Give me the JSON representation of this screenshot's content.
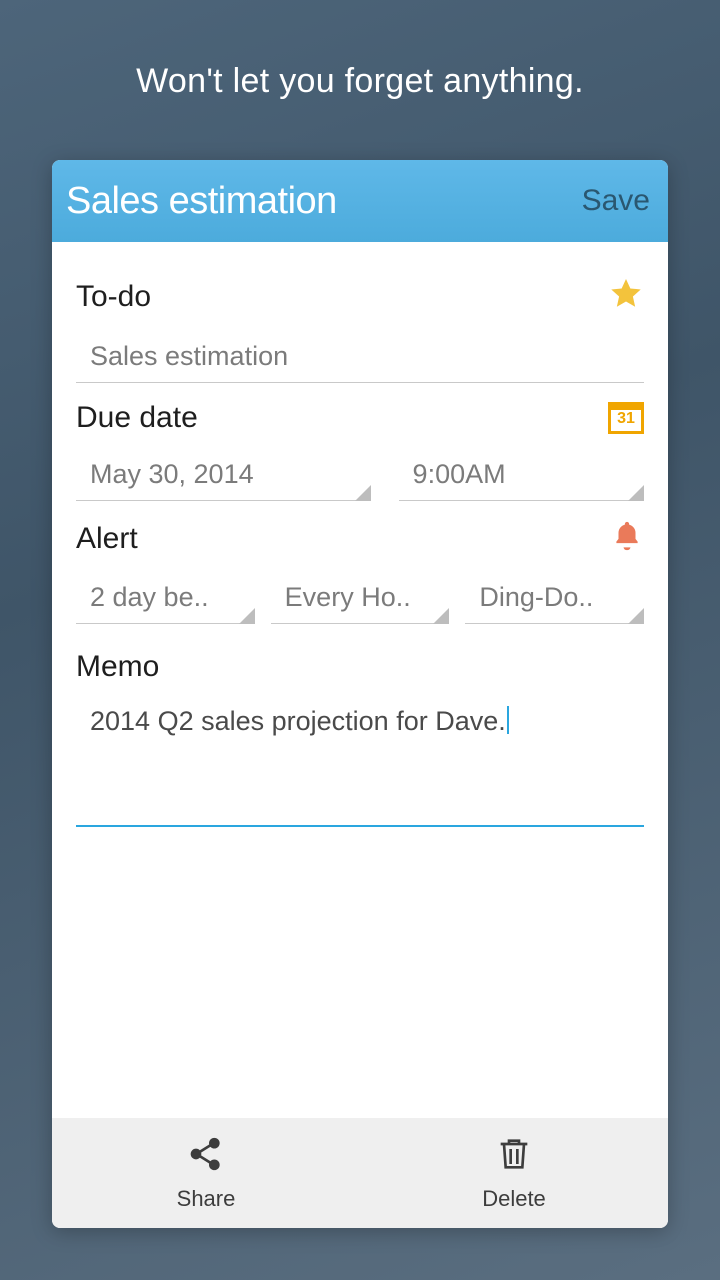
{
  "tagline": "Won't let you forget anything.",
  "header": {
    "title": "Sales estimation",
    "save_label": "Save"
  },
  "todo": {
    "label": "To-do",
    "value": "Sales estimation"
  },
  "due": {
    "label": "Due date",
    "date": "May 30, 2014",
    "time": "9:00AM",
    "cal_day": "31"
  },
  "alert": {
    "label": "Alert",
    "lead": "2 day be..",
    "repeat": "Every Ho..",
    "sound": "Ding-Do.."
  },
  "memo": {
    "label": "Memo",
    "text": "2014 Q2 sales projection for Dave."
  },
  "bottom": {
    "share": "Share",
    "delete": "Delete"
  }
}
